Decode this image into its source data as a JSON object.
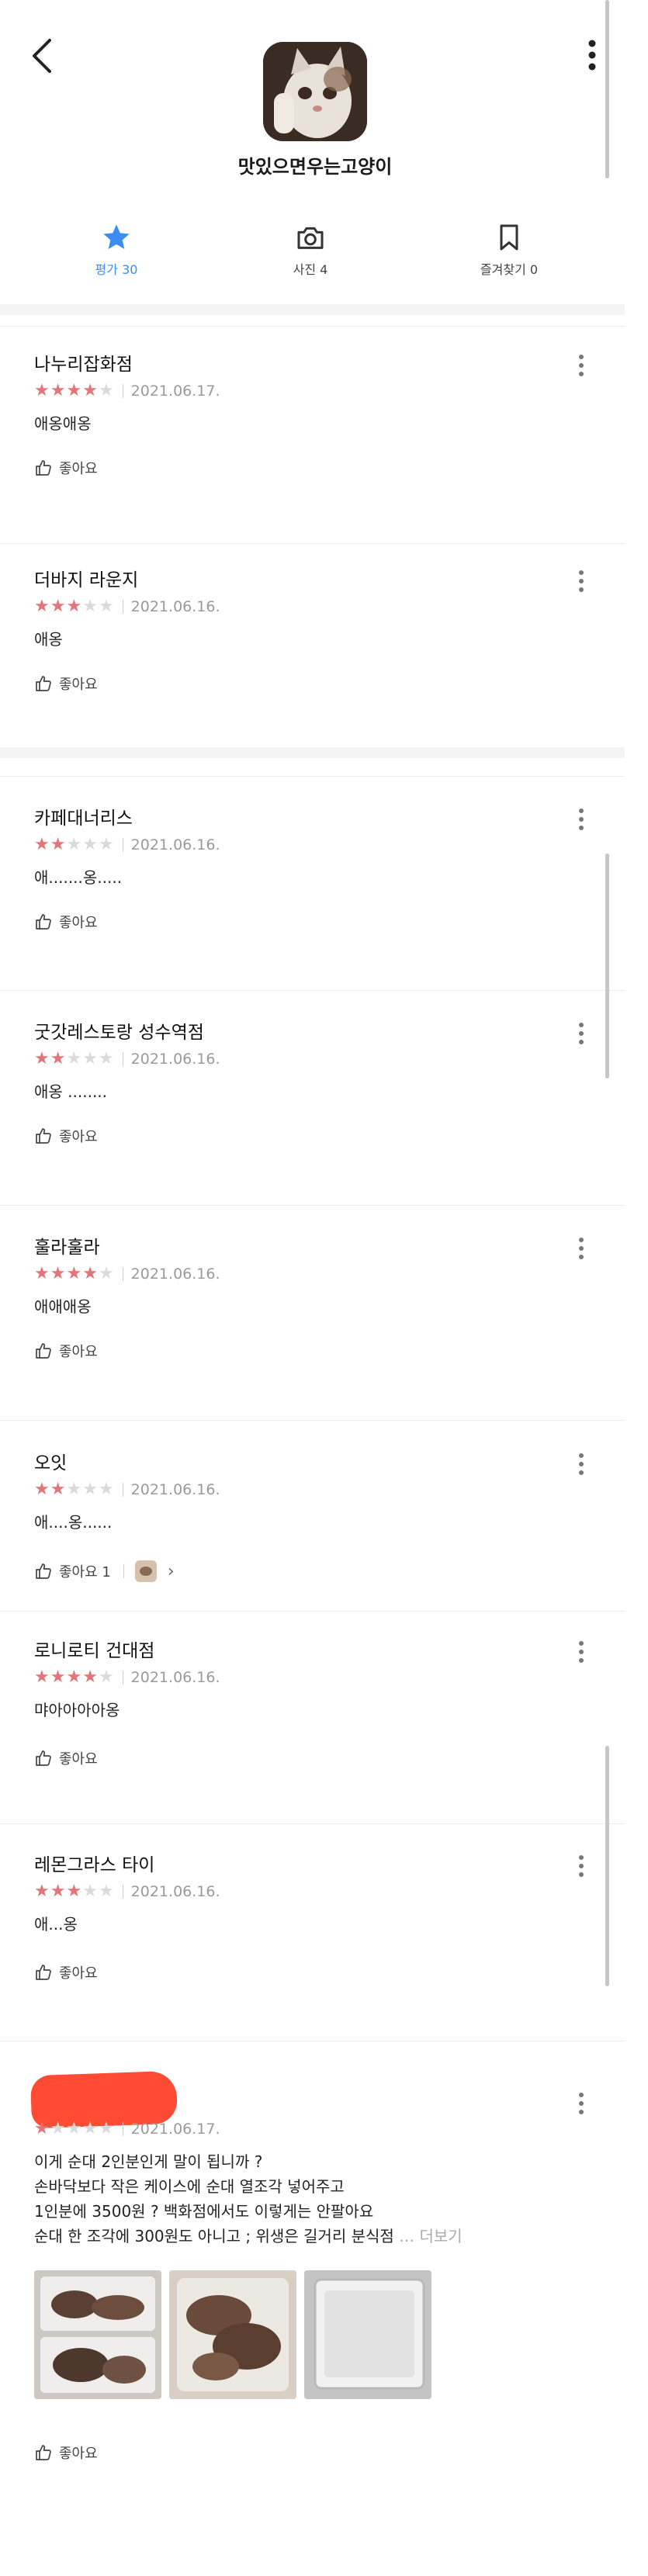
{
  "profile": {
    "nickname": "맛있으면우는고양이",
    "tabs": [
      {
        "label": "평가 30",
        "icon": "star-icon",
        "active": true
      },
      {
        "label": "사진 4",
        "icon": "camera-icon",
        "active": false
      },
      {
        "label": "즐겨찾기 0",
        "icon": "bookmark-icon",
        "active": false
      }
    ]
  },
  "colors": {
    "accent": "#3b8ef0",
    "star_on": "#e2747a",
    "star_off": "#dadada",
    "redaction": "#ff4b33"
  },
  "reviews": [
    {
      "place": "나누리잡화점",
      "stars": 4,
      "date": "2021.06.17.",
      "comment": "애옹애옹",
      "like": "좋아요"
    },
    {
      "place": "더바지 라운지",
      "stars": 3,
      "date": "2021.06.16.",
      "comment": "애옹",
      "like": "좋아요"
    },
    {
      "place": "카페대너리스",
      "stars": 2,
      "date": "2021.06.16.",
      "comment": "애.......옹.....",
      "like": "좋아요"
    },
    {
      "place": "굿갓레스토랑 성수역점",
      "stars": 2,
      "date": "2021.06.16.",
      "comment": "애옹 ........",
      "like": "좋아요"
    },
    {
      "place": "훌라훌라",
      "stars": 4,
      "date": "2021.06.16.",
      "comment": "애애애옹",
      "like": "좋아요"
    },
    {
      "place": "오잇",
      "stars": 2,
      "date": "2021.06.16.",
      "comment": "애....옹......",
      "like": "좋아요 1"
    },
    {
      "place": "로니로티 건대점",
      "stars": 4,
      "date": "2021.06.16.",
      "comment": "먀아아아아옹",
      "like": "좋아요"
    },
    {
      "place": "레몬그라스 타이",
      "stars": 3,
      "date": "2021.06.16.",
      "comment": "애...옹",
      "like": "좋아요"
    }
  ],
  "last_review": {
    "stars": 1,
    "date": "2021.06.17.",
    "lines": [
      "이게 순대 2인분인게 말이 됩니까 ?",
      "손바닥보다 작은 케이스에 순대 열조각 넣어주고",
      "1인분에 3500원 ? 백화점에서도 이렇게는 안팔아요",
      "순대 한 조각에 300원도 아니고 ; 위생은 길거리 분식점"
    ],
    "more": "더보기",
    "like": "좋아요"
  }
}
